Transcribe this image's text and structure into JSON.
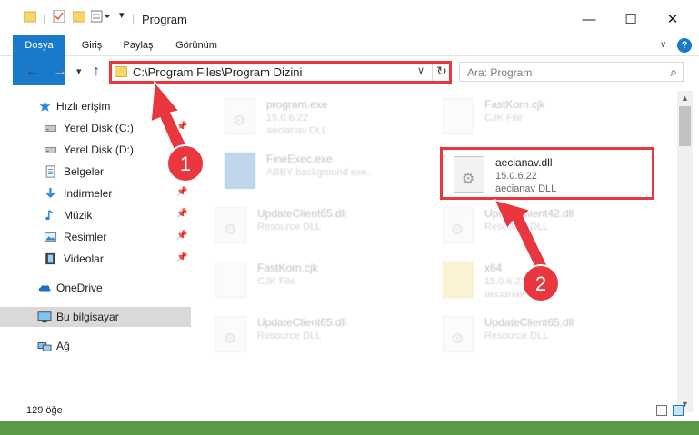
{
  "window": {
    "title": "Program",
    "minimize": "—",
    "maximize": "☐",
    "close": "✕"
  },
  "ribbon": {
    "tabs": [
      "Dosya",
      "Giriş",
      "Paylaş",
      "Görünüm"
    ],
    "help": "?"
  },
  "nav": {
    "back": "←",
    "forward": "→",
    "recent": "▾",
    "up": "↑",
    "address": "C:\\Program Files\\Program Dizini",
    "address_dropdown": "∨",
    "refresh": "↻",
    "search_placeholder": "Ara: Program",
    "search_icon": "⌕"
  },
  "sidebar": {
    "items": [
      {
        "label": "Hızlı erişim",
        "icon": "star-icon"
      },
      {
        "label": "Yerel Disk (C:)",
        "icon": "drive-icon"
      },
      {
        "label": "Yerel Disk (D:)",
        "icon": "drive-icon"
      },
      {
        "label": "Belgeler",
        "icon": "documents-icon"
      },
      {
        "label": "İndirmeler",
        "icon": "downloads-icon"
      },
      {
        "label": "Müzik",
        "icon": "music-icon"
      },
      {
        "label": "Resimler",
        "icon": "pictures-icon"
      },
      {
        "label": "Videolar",
        "icon": "videos-icon"
      },
      {
        "label": "OneDrive",
        "icon": "cloud-icon"
      },
      {
        "label": "Bu bilgisayar",
        "icon": "computer-icon"
      },
      {
        "label": "Ağ",
        "icon": "network-icon"
      }
    ],
    "pin": "📌"
  },
  "files": [
    {
      "name": "program.exe",
      "line2": "15.0.6.22",
      "line3": "aecianav DLL"
    },
    {
      "name": "FastKorn.cjk",
      "line2": "CJK File",
      "line3": ""
    },
    {
      "name": "FineExec.exe",
      "line2": "ABBY background exe...",
      "line3": ""
    },
    {
      "name": "aecianav.dll",
      "line2": "15.0.6.22",
      "line3": "aecianav DLL"
    },
    {
      "name": "UpdateClient65.dll",
      "line2": "Resource DLL",
      "line3": ""
    },
    {
      "name": "UpdateClient42.dll",
      "line2": "Resource DLL",
      "line3": ""
    },
    {
      "name": "FastKorn.cjk",
      "line2": "CJK File",
      "line3": ""
    },
    {
      "name": "x64",
      "line2": "15.0.6.22",
      "line3": "aecianav DLL"
    },
    {
      "name": "UpdateClient65.dll",
      "line2": "Resource DLL",
      "line3": ""
    },
    {
      "name": "UpdateClient65.dll",
      "line2": "Resource DLL",
      "line3": ""
    }
  ],
  "status": {
    "count": "129 öğe"
  },
  "annotations": {
    "step1": "1",
    "step2": "2",
    "color": "#e8373f"
  },
  "colors": {
    "accent": "#1979ca",
    "highlight": "#e8373f",
    "selection": "#d9d9d9"
  }
}
